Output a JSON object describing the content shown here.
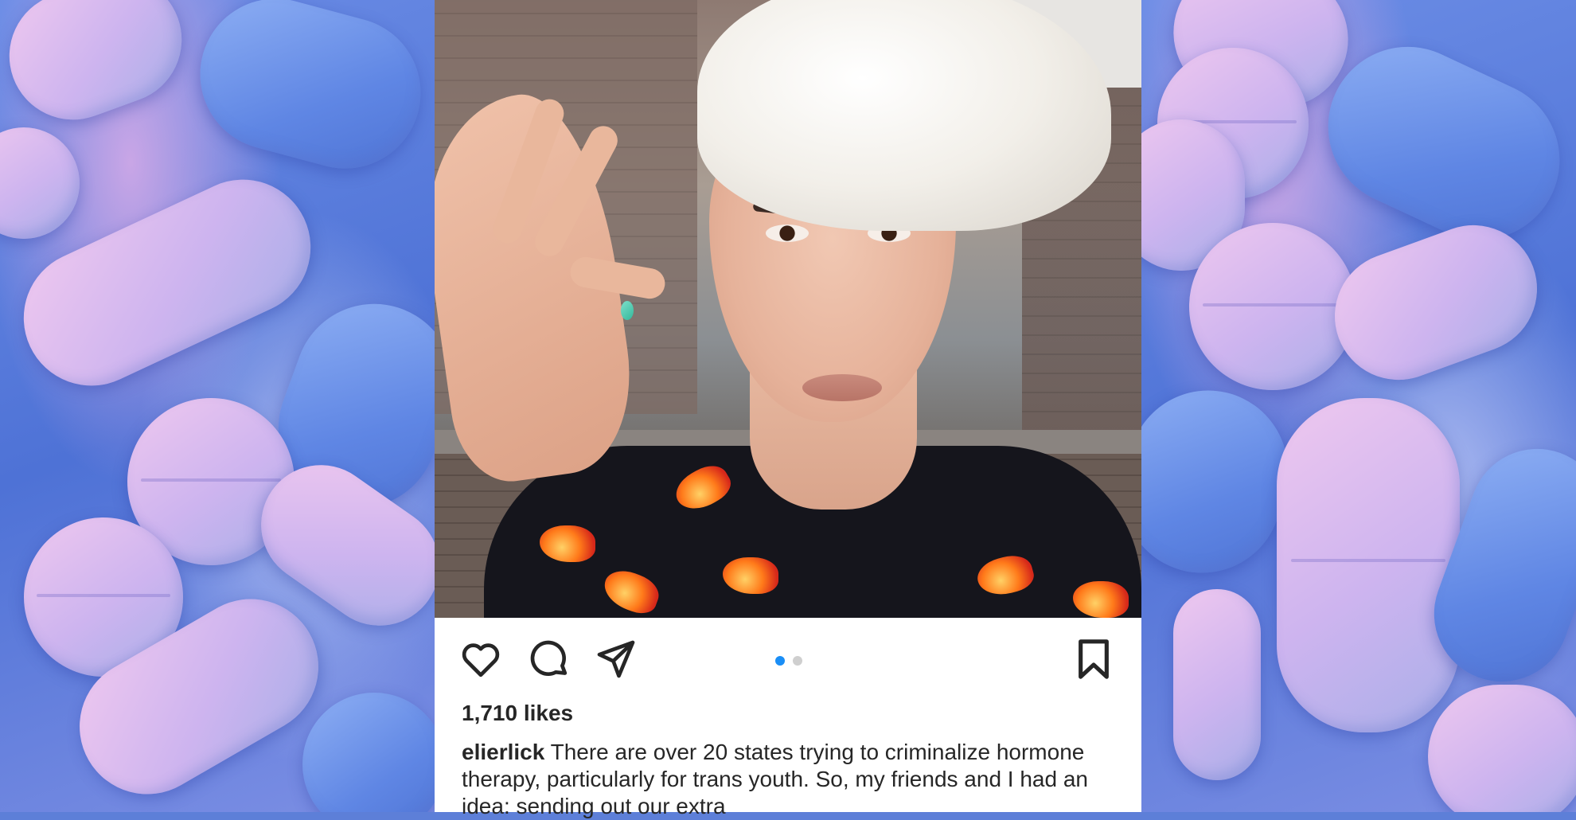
{
  "post": {
    "likes_text": "1,710 likes",
    "username": "elierlick",
    "caption_text": "There are over 20 states trying to criminalize hormone therapy, particularly for trans youth. So, my friends and I had an idea: sending out our extra",
    "carousel": {
      "count": 2,
      "active_index": 0
    }
  },
  "icons": {
    "like": "heart-icon",
    "comment": "comment-icon",
    "share": "send-icon",
    "save": "bookmark-icon"
  },
  "colors": {
    "carousel_active": "#1a8ef6",
    "text": "#262626"
  }
}
